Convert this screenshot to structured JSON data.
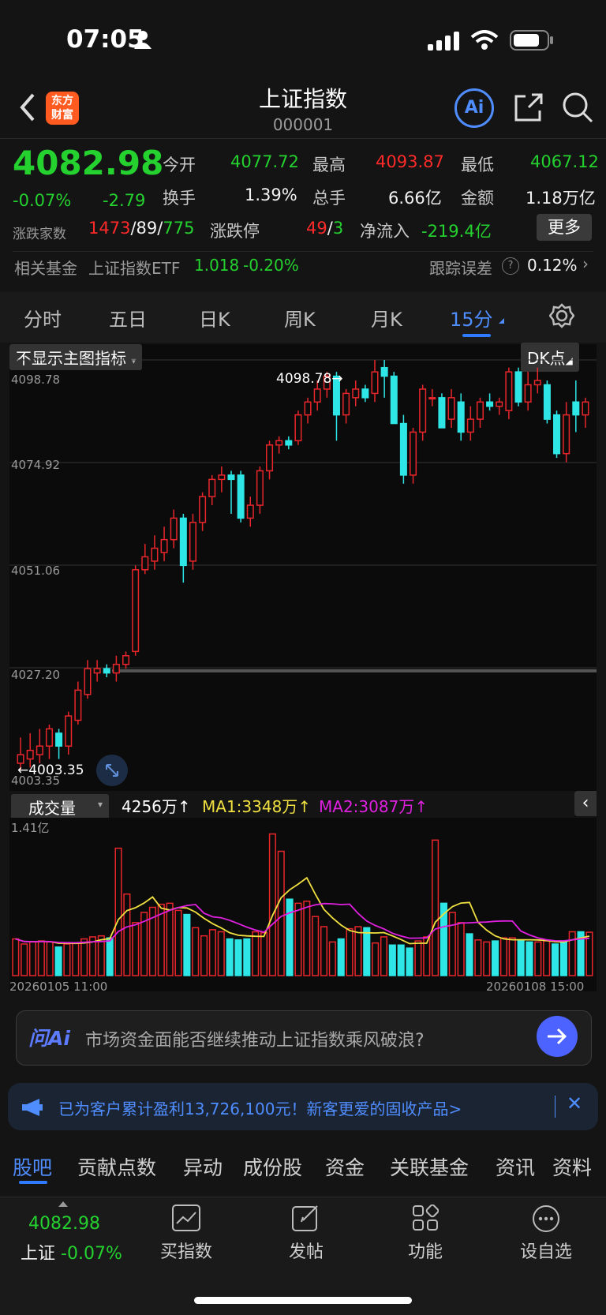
{
  "status_bar": {
    "time": "07:05"
  },
  "header": {
    "title": "上证指数",
    "code": "000001",
    "logo_text_1": "东方",
    "logo_text_2": "财富",
    "ai_label": "Ai"
  },
  "quote": {
    "price": "4082.98",
    "change_pct": "-0.07%",
    "change_abs": "-2.79",
    "open_label": "今开",
    "open": "4077.72",
    "high_label": "最高",
    "high": "4093.87",
    "low_label": "最低",
    "low": "4067.12",
    "turnover_label": "换手",
    "turnover": "1.39%",
    "volume_label": "总手",
    "volume": "6.66亿",
    "amount_label": "金额",
    "amount": "1.18万亿",
    "breadth_label": "涨跌家数",
    "breadth_up": "1473",
    "breadth_flat": "89",
    "breadth_down": "775",
    "limit_label": "涨跌停",
    "limit_up": "49",
    "limit_down": "3",
    "inflow_label": "净流入",
    "inflow": "-219.4亿",
    "more_button": "更多",
    "fund_label": "相关基金",
    "fund_name": "上证指数ETF",
    "fund_price": "1.018",
    "fund_change": "-0.20%",
    "tracking_label": "跟踪误差",
    "tracking_value": "0.12%"
  },
  "period_tabs": [
    "分时",
    "五日",
    "日K",
    "周K",
    "月K",
    "15分"
  ],
  "active_tab": "15分",
  "chart": {
    "indicator_dropdown": "不显示主图指标",
    "dk_button": "DK点",
    "y_labels": [
      "4098.78",
      "4074.92",
      "4051.06",
      "4027.20",
      "4003.35"
    ],
    "max_marker": "4098.78→",
    "min_marker": "←4003.35",
    "volume_dropdown": "成交量",
    "vol_value": "4256万",
    "ma1": "MA1:3348万",
    "ma2": "MA2:3087万",
    "vol_axis_max": "1.41亿",
    "date_start": "20260105 11:00",
    "date_end": "20260108 15:00",
    "colors": {
      "up": "#e8262b",
      "down": "#2ee6e6",
      "ma1": "#f0e040",
      "ma2": "#e020e0"
    }
  },
  "chart_data": {
    "type": "candlestick",
    "ylim": [
      4003.35,
      4098.78
    ],
    "candles": [
      [
        4005,
        4003.35,
        4007,
        4011
      ],
      [
        4006,
        4004,
        4008,
        4012
      ],
      [
        4007,
        4005,
        4009,
        4013
      ],
      [
        4009,
        4006,
        4013,
        4014
      ],
      [
        4012,
        4006,
        4009,
        4013
      ],
      [
        4009,
        4007,
        4016,
        4017
      ],
      [
        4015,
        4014,
        4022,
        4024
      ],
      [
        4021,
        4020,
        4027,
        4029
      ],
      [
        4026,
        4024,
        4027,
        4029
      ],
      [
        4027,
        4025,
        4026,
        4028
      ],
      [
        4026,
        4024,
        4028,
        4030
      ],
      [
        4028,
        4027,
        4030,
        4031
      ],
      [
        4031,
        4030,
        4050,
        4051
      ],
      [
        4050,
        4049,
        4053,
        4056
      ],
      [
        4052,
        4050,
        4055,
        4058
      ],
      [
        4054,
        4052,
        4057,
        4060
      ],
      [
        4057,
        4055,
        4062,
        4064
      ],
      [
        4062,
        4047,
        4051,
        4063
      ],
      [
        4052,
        4050,
        4061,
        4063
      ],
      [
        4061,
        4059,
        4067,
        4068
      ],
      [
        4067,
        4065,
        4071,
        4072
      ],
      [
        4071,
        4068,
        4072,
        4074
      ],
      [
        4072,
        4063,
        4071,
        4073
      ],
      [
        4072,
        4061,
        4062,
        4073
      ],
      [
        4062,
        4060,
        4065,
        4067
      ],
      [
        4065,
        4063,
        4073,
        4074
      ],
      [
        4073,
        4071,
        4079,
        4080
      ],
      [
        4079,
        4077,
        4080,
        4081
      ],
      [
        4080,
        4078,
        4079,
        4081
      ],
      [
        4080,
        4079,
        4086,
        4087
      ],
      [
        4086,
        4084,
        4089,
        4090
      ],
      [
        4089,
        4087,
        4092,
        4094
      ],
      [
        4092,
        4090,
        4095,
        4096
      ],
      [
        4095,
        4080,
        4086,
        4096
      ],
      [
        4086,
        4084,
        4091,
        4092
      ],
      [
        4090,
        4088,
        4092,
        4094
      ],
      [
        4092,
        4089,
        4090,
        4093
      ],
      [
        4091,
        4089,
        4096,
        4098.78
      ],
      [
        4097,
        4090,
        4095,
        4098.78
      ],
      [
        4095,
        4084,
        4084,
        4096
      ],
      [
        4084,
        4070,
        4072,
        4086
      ],
      [
        4072,
        4070,
        4082,
        4083
      ],
      [
        4082,
        4080,
        4092,
        4093
      ],
      [
        4090,
        4088,
        4090,
        4092
      ],
      [
        4090,
        4083,
        4083,
        4091
      ],
      [
        4085,
        4083,
        4090,
        4092
      ],
      [
        4089,
        4080,
        4082,
        4091
      ],
      [
        4082,
        4080,
        4085,
        4088
      ],
      [
        4085,
        4083,
        4089,
        4090
      ],
      [
        4089,
        4087,
        4088,
        4091
      ],
      [
        4088,
        4086,
        4089,
        4090
      ],
      [
        4087,
        4085,
        4096,
        4097
      ],
      [
        4096,
        4088,
        4089,
        4097
      ],
      [
        4089,
        4087,
        4093,
        4096
      ],
      [
        4093,
        4091,
        4094,
        4097
      ],
      [
        4093,
        4084,
        4085,
        4094
      ],
      [
        4086,
        4076,
        4077,
        4087
      ],
      [
        4077,
        4075,
        4086,
        4089
      ],
      [
        4089,
        4082,
        4086,
        4094
      ],
      [
        4086,
        4083,
        4089,
        4090
      ]
    ],
    "volume_units": "万",
    "volume": [
      3600,
      3100,
      3300,
      3400,
      3300,
      2800,
      3100,
      3200,
      3600,
      3800,
      3900,
      3700,
      12500,
      8000,
      5200,
      6200,
      6700,
      7000,
      7100,
      6400,
      6000,
      4700,
      3900,
      4500,
      4300,
      3600,
      3500,
      3600,
      4300,
      4200,
      13900,
      12200,
      7500,
      7100,
      7300,
      5800,
      4800,
      3300,
      3600,
      4600,
      4800,
      4700,
      3200,
      3800,
      3000,
      3000,
      2700,
      3400,
      3800,
      13300,
      7100,
      6200,
      5200,
      4100,
      3500,
      3300,
      3400,
      3700,
      3700,
      3500,
      3300,
      3300,
      3400,
      3100,
      3400,
      4300,
      4300,
      4256
    ],
    "vol_ylim": [
      0,
      14100
    ]
  },
  "ai_bar": {
    "brand": "问Ai",
    "prompt": "市场资金面能否继续推动上证指数乘风破浪?"
  },
  "promo": {
    "text": "已为客户累计盈利13,726,100元！新客更爱的固收产品>"
  },
  "sub_tabs": [
    "股吧",
    "贡献点数",
    "异动",
    "成份股",
    "资金",
    "关联基金",
    "资讯",
    "资料"
  ],
  "bottom": {
    "price": "4082.98",
    "name": "上证",
    "change": "-0.07%",
    "buttons": [
      "买指数",
      "发帖",
      "功能",
      "设自选"
    ]
  }
}
